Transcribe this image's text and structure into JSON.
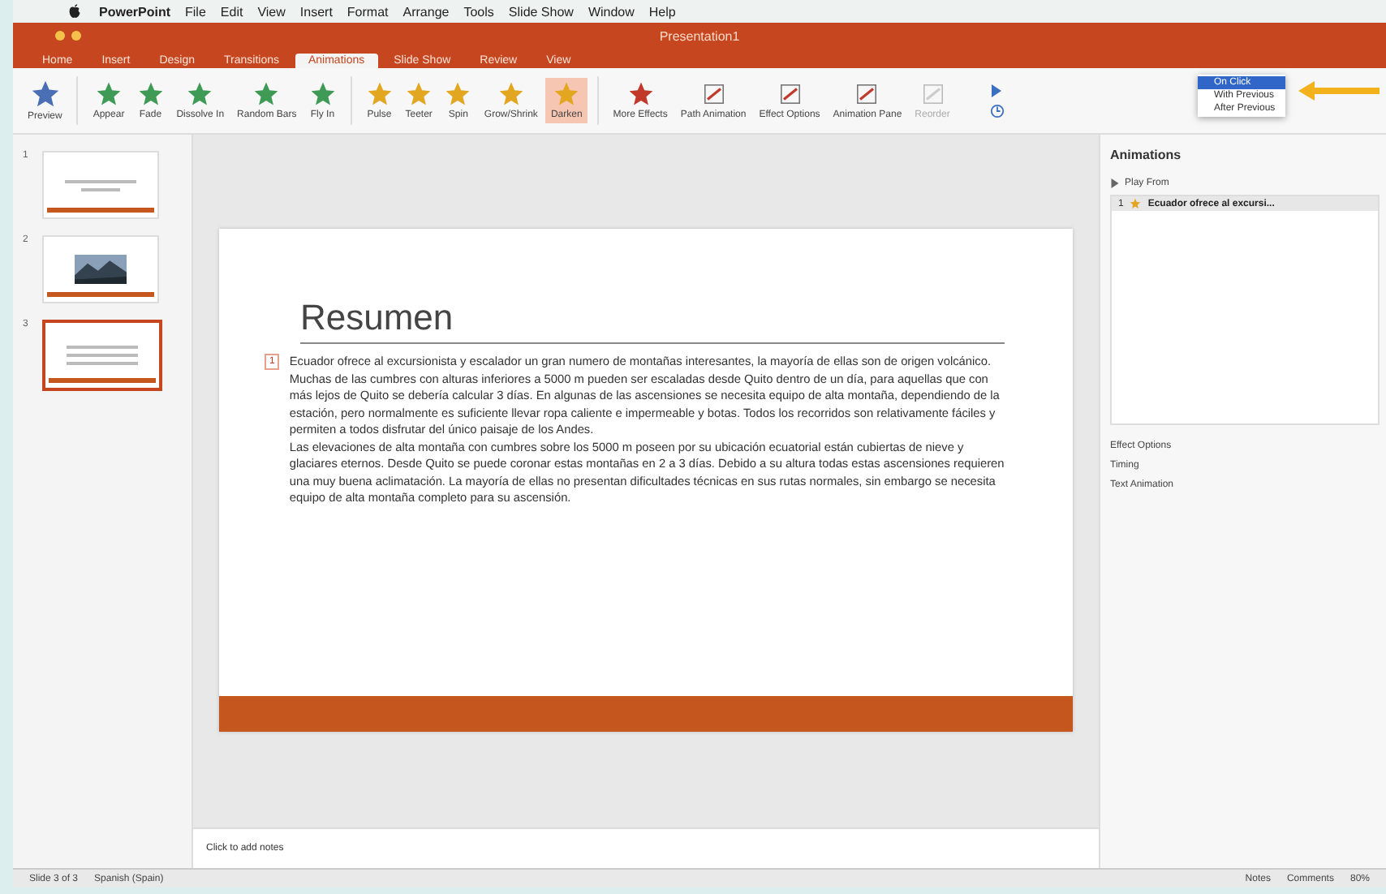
{
  "menu_bar": [
    "PowerPoint",
    "File",
    "Edit",
    "View",
    "Insert",
    "Format",
    "Arrange",
    "Tools",
    "Slide Show",
    "Window",
    "Help"
  ],
  "window": {
    "title": "Presentation1"
  },
  "tabs": [
    {
      "label": "Home",
      "selected": false
    },
    {
      "label": "Insert",
      "selected": false
    },
    {
      "label": "Design",
      "selected": false
    },
    {
      "label": "Transitions",
      "selected": false
    },
    {
      "label": "Animations",
      "selected": true
    },
    {
      "label": "Slide Show",
      "selected": false
    },
    {
      "label": "Review",
      "selected": false
    },
    {
      "label": "View",
      "selected": false
    }
  ],
  "ribbon": {
    "preview": "Preview",
    "effects": [
      {
        "label": "Appear",
        "kind": "entrance",
        "selected": false
      },
      {
        "label": "Fade",
        "kind": "entrance",
        "selected": false
      },
      {
        "label": "Dissolve In",
        "kind": "entrance",
        "selected": false
      },
      {
        "label": "Random Bars",
        "kind": "entrance",
        "selected": false
      },
      {
        "label": "Fly In",
        "kind": "entrance",
        "selected": false
      },
      {
        "label": "Pulse",
        "kind": "emphasis",
        "selected": false
      },
      {
        "label": "Teeter",
        "kind": "emphasis",
        "selected": false
      },
      {
        "label": "Spin",
        "kind": "emphasis",
        "selected": false
      },
      {
        "label": "Grow/Shrink",
        "kind": "emphasis",
        "selected": false
      },
      {
        "label": "Darken",
        "kind": "emphasis",
        "selected": true
      }
    ],
    "tools": [
      {
        "label": "More Effects",
        "disabled": false
      },
      {
        "label": "Path Animation",
        "disabled": false
      },
      {
        "label": "Effect Options",
        "disabled": false
      },
      {
        "label": "Animation Pane",
        "disabled": false
      },
      {
        "label": "Reorder",
        "disabled": true
      }
    ],
    "start_menu": [
      {
        "label": "On Click",
        "selected": true
      },
      {
        "label": "With Previous",
        "selected": false
      },
      {
        "label": "After Previous",
        "selected": false
      }
    ]
  },
  "thumbnails": [
    {
      "number": "1",
      "selected": false,
      "kind": "title"
    },
    {
      "number": "2",
      "selected": false
    },
    {
      "number": "3",
      "selected": true,
      "kind": "text"
    }
  ],
  "slide": {
    "title": "Resumen",
    "animation_tag": "1",
    "paragraphs": [
      "Ecuador ofrece al excursionista y escalador un gran numero de montañas interesantes, la mayoría de ellas son de origen volcánico. Muchas de las cumbres con alturas inferiores a 5000 m pueden ser escaladas desde Quito dentro de un día, para aquellas que con más lejos de Quito se debería calcular 3 días. En algunas de las ascensiones se necesita equipo de alta montaña, dependiendo de la estación, pero normalmente es suficiente llevar ropa caliente e impermeable y botas. Todos los recorridos son relativamente fáciles y permiten a todos disfrutar del único paisaje de los Andes.",
      "Las elevaciones de alta montaña con cumbres sobre los 5000 m poseen por su ubicación ecuatorial están cubiertas de nieve y glaciares eternos. Desde Quito se puede coronar estas montañas en 2 a 3 días. Debido a su altura todas estas ascensiones requieren una muy buena aclimatación. La mayoría de ellas no presentan dificultades técnicas en sus rutas normales, sin embargo se necesita equipo de alta montaña completo para su ascensión."
    ]
  },
  "notes": {
    "placeholder": "Click to add notes"
  },
  "animation_pane": {
    "title": "Animations",
    "play_from": "Play From",
    "items": [
      {
        "number": "1",
        "label": "Ecuador ofrece al excursi..."
      }
    ],
    "sections": [
      "Effect Options",
      "Timing",
      "Text Animation"
    ]
  },
  "status_bar": {
    "slide": "Slide 3 of 3",
    "language": "Spanish (Spain)",
    "notes": "Notes",
    "comments": "Comments",
    "zoom": "80%"
  }
}
